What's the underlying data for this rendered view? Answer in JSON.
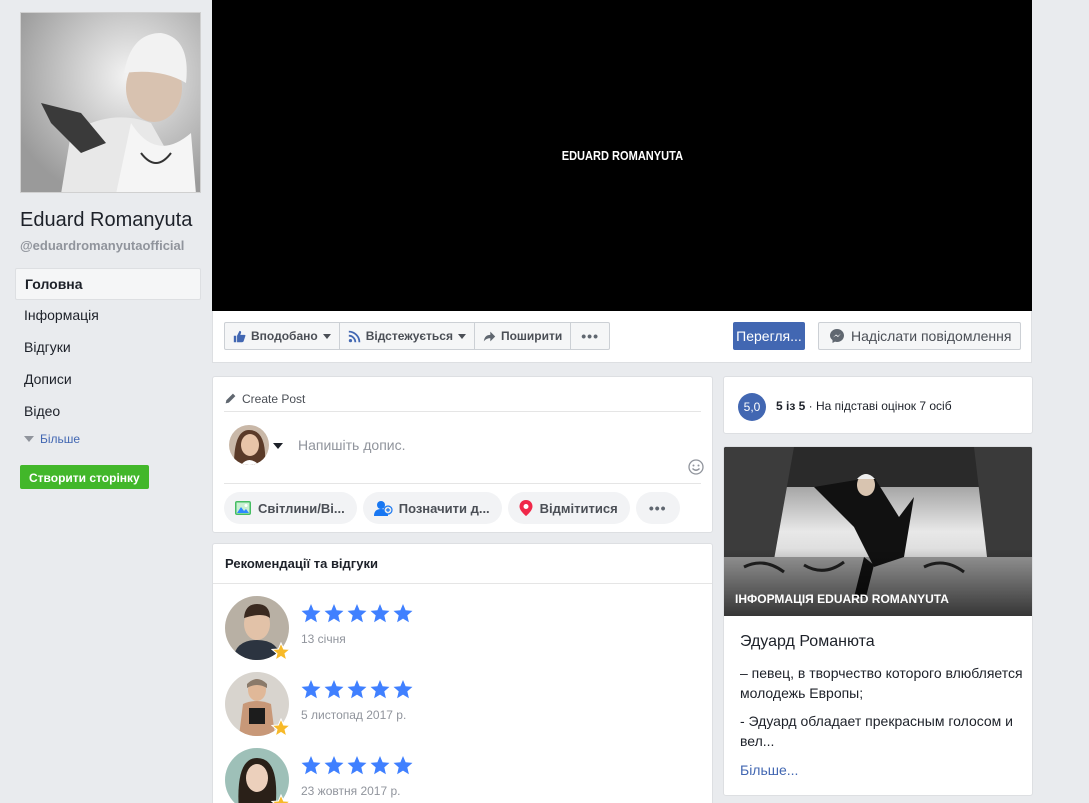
{
  "sidebar": {
    "page_name": "Eduard Romanyuta",
    "handle": "@eduardromanyutaofficial",
    "nav": [
      {
        "label": "Головна"
      },
      {
        "label": "Інформація"
      },
      {
        "label": "Відгуки"
      },
      {
        "label": "Дописи"
      },
      {
        "label": "Відео"
      }
    ],
    "more_label": "Більше",
    "create_page_label": "Створити сторінку"
  },
  "cover": {
    "text": "EDUARD ROMANYUTA"
  },
  "actions": {
    "like_label": "Вподобано",
    "follow_label": "Відстежується",
    "share_label": "Поширити",
    "view_label": "Перегля...",
    "message_label": "Надіслати повідомлення"
  },
  "create_post": {
    "title": "Create Post",
    "placeholder": "Напишіть допис.",
    "photo_label": "Світлини/Ві...",
    "tag_label": "Позначити д...",
    "checkin_label": "Відмітитися"
  },
  "reviews": {
    "title": "Рекомендації та відгуки",
    "items": [
      {
        "date": "13 січня",
        "rating": 5
      },
      {
        "date": "5 листопад 2017 р.",
        "rating": 5
      },
      {
        "date": "23 жовтня 2017 р.",
        "rating": 5
      }
    ]
  },
  "rating_summary": {
    "score": "5,0",
    "out_of": "5 із 5",
    "separator": " · ",
    "basis": "На підставі оцінок 7 осіб"
  },
  "about": {
    "caption": "ІНФОРМАЦІЯ EDUARD ROMANYUTA",
    "title": "Эдуард Романюта",
    "p1": "– певец, в творчество которого влюбляется молодежь Европы;",
    "p2": "- Эдуард обладает прекрасным голосом и вел...",
    "more": "Більше..."
  },
  "colors": {
    "brand_blue": "#4267b2",
    "green": "#42b72a",
    "background": "#e9ebee",
    "star_blue": "#4080ff",
    "badge_gold": "#f7b928"
  }
}
